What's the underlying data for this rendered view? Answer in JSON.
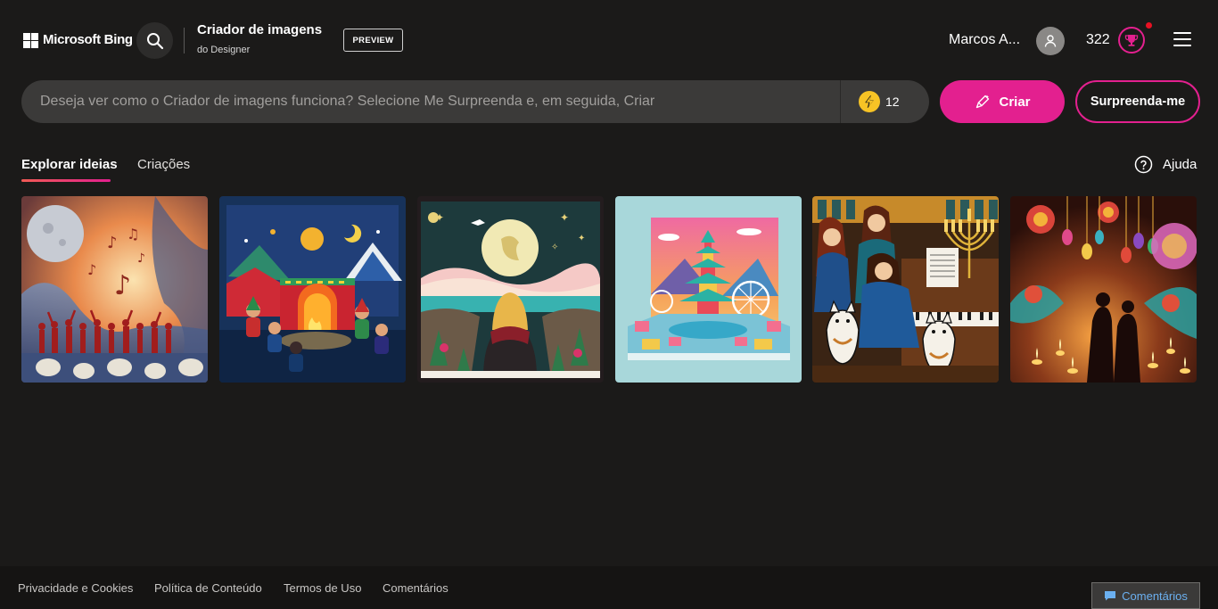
{
  "header": {
    "brand": "Microsoft Bing",
    "app_title": "Criador de imagens",
    "app_subtitle": "do Designer",
    "preview_badge": "PREVIEW",
    "user_name": "Marcos A...",
    "points": "322",
    "icons": [
      "microsoft-logo-icon",
      "search-icon",
      "user-icon",
      "trophy-icon",
      "hamburger-menu-icon"
    ]
  },
  "prompt": {
    "placeholder": "Deseja ver como o Criador de imagens funciona? Selecione Me Surpreenda e, em seguida, Criar",
    "value": "",
    "boost_count": "12",
    "create_label": "Criar",
    "surprise_label": "Surpreenda-me"
  },
  "tabs": [
    {
      "label": "Explorar ideias",
      "active": true
    },
    {
      "label": "Criações",
      "active": false
    }
  ],
  "help_label": "Ajuda",
  "gallery": [
    {
      "icon": "image-thumbnail",
      "scene": "choir-music-moon"
    },
    {
      "icon": "image-thumbnail",
      "scene": "felt-campfire-night"
    },
    {
      "icon": "image-thumbnail",
      "scene": "felt-woman-dove-moon"
    },
    {
      "icon": "image-thumbnail",
      "scene": "papercraft-pagoda"
    },
    {
      "icon": "image-thumbnail",
      "scene": "women-piano-cats-menorah"
    },
    {
      "icon": "image-thumbnail",
      "scene": "lanterns-diwali"
    }
  ],
  "footer": {
    "links": [
      "Privacidade e Cookies",
      "Política de Conteúdo",
      "Termos de Uso",
      "Comentários"
    ],
    "feedback_label": "Comentários"
  },
  "colors": {
    "background": "#1b1a19",
    "accent": "#e3208f",
    "input_bg": "#3b3a39",
    "boost": "#f7c325"
  }
}
